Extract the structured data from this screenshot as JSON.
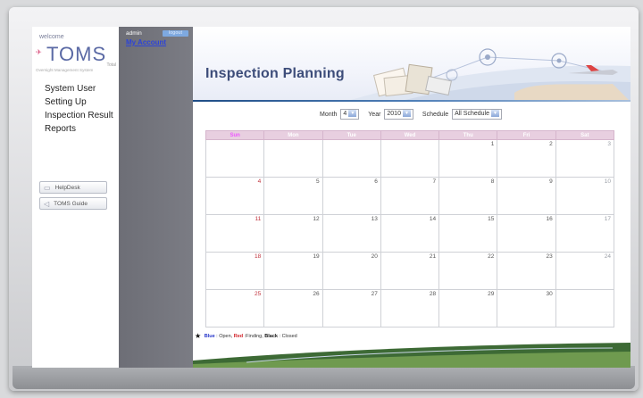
{
  "sidebar": {
    "welcome": "welcome",
    "logo_text": "TOMS",
    "logo_sub1": "Total",
    "logo_sub2": "Oversight Management System",
    "nav": [
      "System User",
      "Setting Up",
      "Inspection Result",
      "Reports"
    ],
    "helpdesk_label": "HelpDesk",
    "guide_label": "TOMS Guide"
  },
  "admin": {
    "username": "admin",
    "logout_label": "logout",
    "account_label": "My Account"
  },
  "page_title": "Inspection Planning",
  "filters": {
    "month_label": "Month",
    "month_value": "4",
    "year_label": "Year",
    "year_value": "2010",
    "schedule_label": "Schedule",
    "schedule_value": "All Schedule"
  },
  "calendar": {
    "weekdays": [
      "Sun",
      "Mon",
      "Tue",
      "Wed",
      "Thu",
      "Fri",
      "Sat"
    ],
    "weeks": [
      [
        "",
        "",
        "",
        "",
        "1",
        "2",
        "3"
      ],
      [
        "4",
        "5",
        "6",
        "7",
        "8",
        "9",
        "10"
      ],
      [
        "11",
        "12",
        "13",
        "14",
        "15",
        "16",
        "17"
      ],
      [
        "18",
        "19",
        "20",
        "21",
        "22",
        "23",
        "24"
      ],
      [
        "25",
        "26",
        "27",
        "28",
        "29",
        "30",
        ""
      ]
    ]
  },
  "legend": {
    "blue": "Blue",
    "blue_desc": ": Open,",
    "red": "Red",
    "red_desc": ":Finding,",
    "black": "Black",
    "black_desc": ": Closed"
  },
  "colors": {
    "accent": "#3d4d7a",
    "sunday": "#c0323c",
    "open": "#2333c9",
    "finding": "#d1232a"
  }
}
